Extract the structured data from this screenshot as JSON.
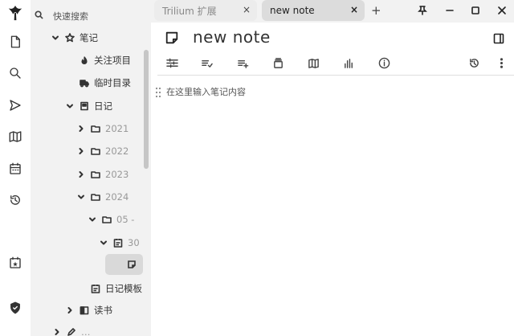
{
  "launcher": {
    "items": [
      {
        "icon": "trilium-logo-icon"
      },
      {
        "icon": "new-note-icon"
      },
      {
        "icon": "search-icon"
      },
      {
        "icon": "send-icon"
      },
      {
        "icon": "map-icon"
      },
      {
        "icon": "calendar-icon"
      },
      {
        "icon": "history-icon"
      },
      {
        "icon": "calendar-star-icon"
      },
      {
        "icon": "shield-icon"
      }
    ]
  },
  "search": {
    "placeholder": "快速搜索"
  },
  "tree": {
    "root": "笔记",
    "bookmarks": "关注项目",
    "temp": "临时目录",
    "journal": "日记",
    "years": [
      "2021",
      "2022",
      "2023",
      "2024"
    ],
    "month": "05 - ",
    "day": "30",
    "template": "日记模板",
    "books": "读书",
    "partial": "…"
  },
  "tabs": [
    {
      "title": "Trilium 扩展",
      "close": "×",
      "active": false
    },
    {
      "title": "new note",
      "close": "×",
      "active": true
    }
  ],
  "new_tab": "+",
  "note": {
    "title": "new note",
    "placeholder": "在这里输入笔记内容"
  },
  "ribbon": {
    "left_icons": [
      "properties-icon",
      "promoted-attributes-icon",
      "add-list-icon",
      "note-actions-icon",
      "note-map-icon",
      "chart-icon",
      "info-icon"
    ],
    "right_icons": [
      "revisions-icon",
      "more-menu-icon"
    ]
  },
  "window_controls": [
    "pin-icon",
    "minimize-icon",
    "maximize-icon",
    "close-icon"
  ]
}
